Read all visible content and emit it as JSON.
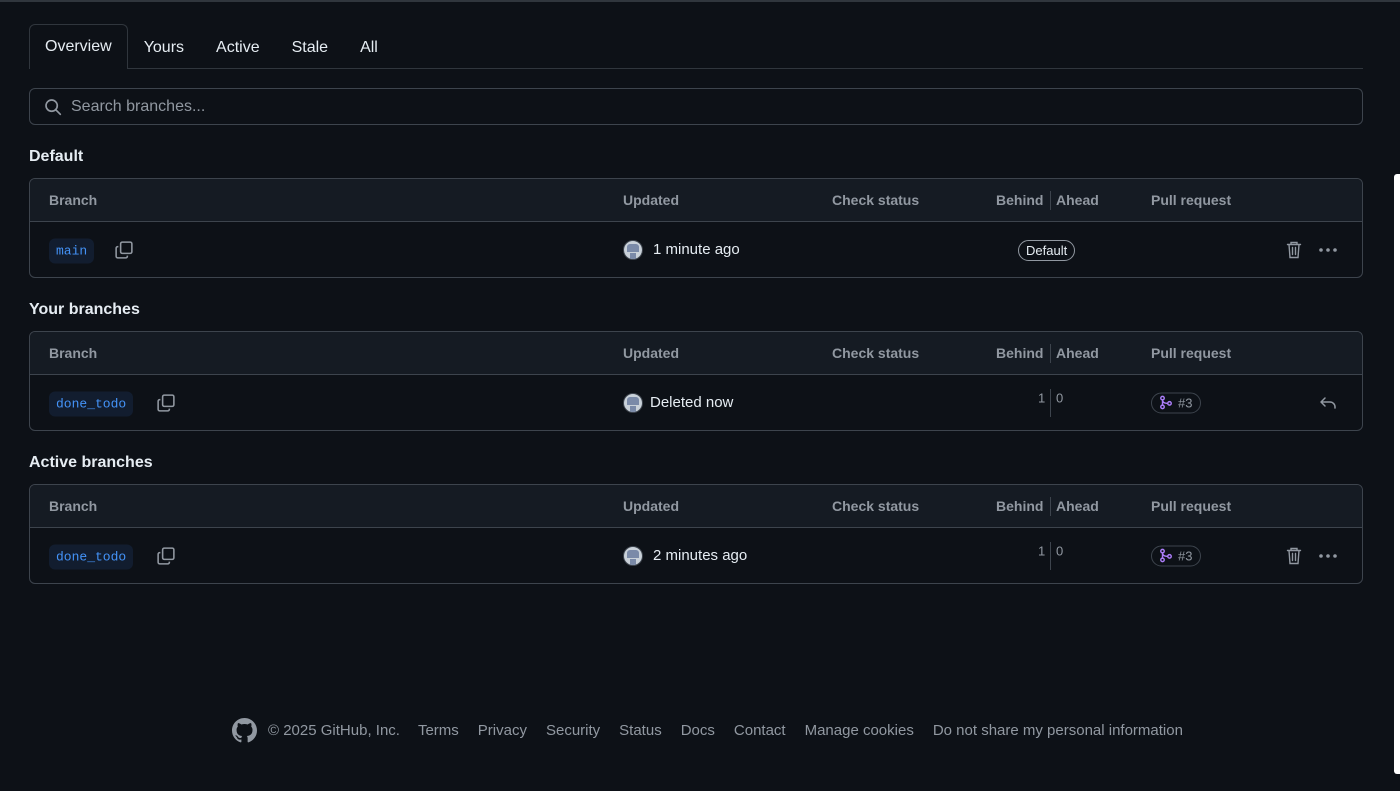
{
  "tabs": [
    "Overview",
    "Yours",
    "Active",
    "Stale",
    "All"
  ],
  "search": {
    "placeholder": "Search branches..."
  },
  "columns": {
    "branch": "Branch",
    "updated": "Updated",
    "check_status": "Check status",
    "behind": "Behind",
    "ahead": "Ahead",
    "pull_request": "Pull request"
  },
  "sections": {
    "default": {
      "title": "Default",
      "row": {
        "branch": "main",
        "updated": "1 minute ago",
        "badge": "Default"
      }
    },
    "yours": {
      "title": "Your branches",
      "row": {
        "branch": "done_todo",
        "updated": "Deleted now",
        "behind": "1",
        "ahead": "0",
        "pr": "#3"
      }
    },
    "active": {
      "title": "Active branches",
      "row": {
        "branch": "done_todo",
        "updated": "2 minutes ago",
        "behind": "1",
        "ahead": "0",
        "pr": "#3"
      }
    }
  },
  "footer": {
    "copyright": "© 2025 GitHub, Inc.",
    "links": [
      "Terms",
      "Privacy",
      "Security",
      "Status",
      "Docs",
      "Contact",
      "Manage cookies",
      "Do not share my personal information"
    ]
  },
  "colors": {
    "link": "#4493f8",
    "pr_merged": "#ab7df8",
    "bg": "#0d1117"
  },
  "icons": [
    "search-icon",
    "copy-icon",
    "trash-icon",
    "kebab-icon",
    "restore-icon",
    "git-merge-icon",
    "github-logo-icon"
  ]
}
